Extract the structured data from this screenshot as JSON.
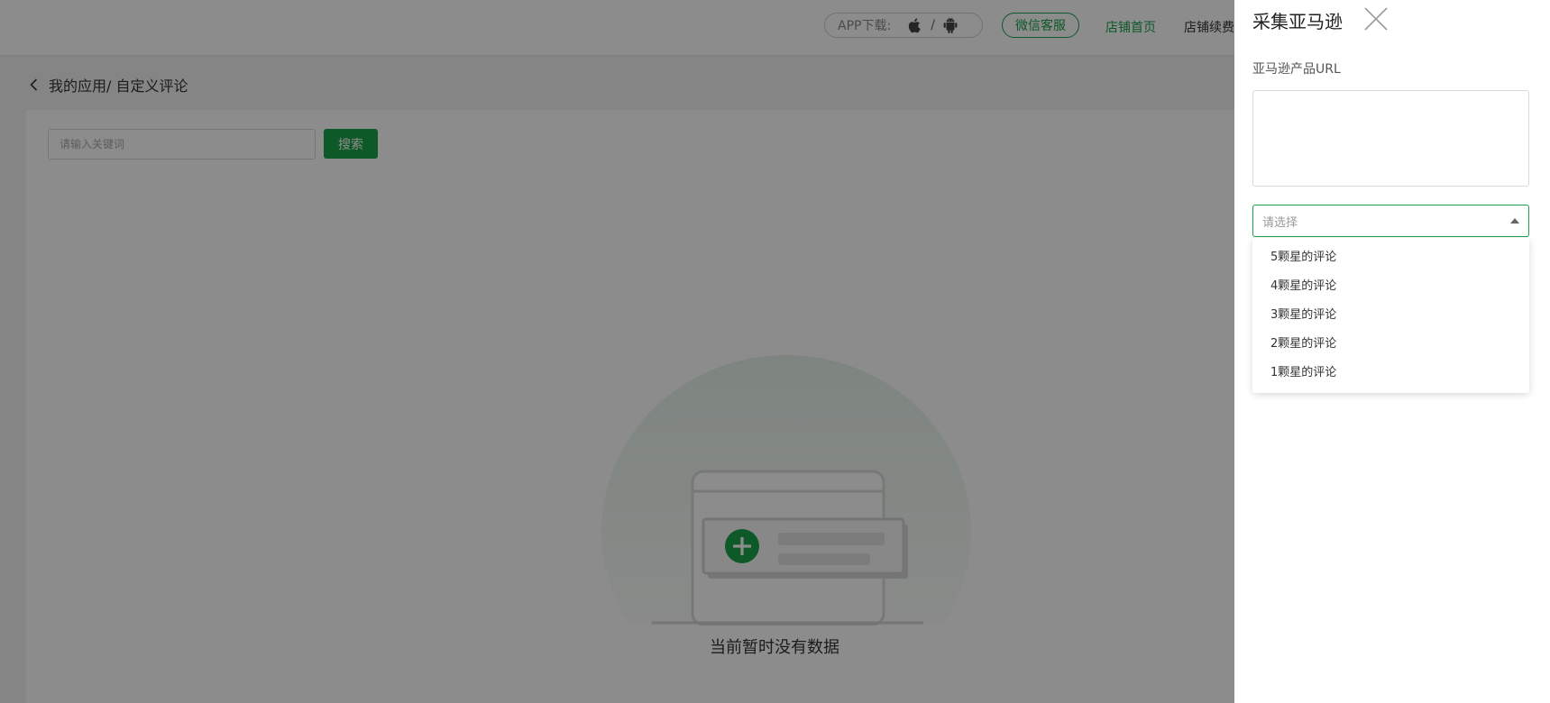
{
  "header": {
    "app_download_label": "APP下载:",
    "app_download_separator": "/",
    "wechat_service": "微信客服",
    "nav_store_home": "店铺首页",
    "nav_store_renew": "店铺续费"
  },
  "breadcrumb": {
    "text": "我的应用/ 自定义评论"
  },
  "search": {
    "placeholder": "请输入关键词",
    "button_label": "搜索"
  },
  "empty_state": {
    "text": "当前暂时没有数据"
  },
  "drawer": {
    "title": "采集亚马逊",
    "url_label": "亚马逊产品URL",
    "url_value": "",
    "select_placeholder": "请选择",
    "options": [
      {
        "label": "5颗星的评论"
      },
      {
        "label": "4颗星的评论"
      },
      {
        "label": "3颗星的评论"
      },
      {
        "label": "2颗星的评论"
      },
      {
        "label": "1颗星的评论"
      }
    ]
  },
  "colors": {
    "accent": "#1aa34a",
    "overlay": "rgba(0,0,0,0.45)",
    "illustration_gray": "#e3e3e3"
  },
  "icons": {
    "apple": "apple-icon",
    "android": "android-icon",
    "back": "chevron-left-icon",
    "close": "close-icon",
    "select_arrow": "caret-up-icon",
    "empty": "empty-illustration"
  }
}
